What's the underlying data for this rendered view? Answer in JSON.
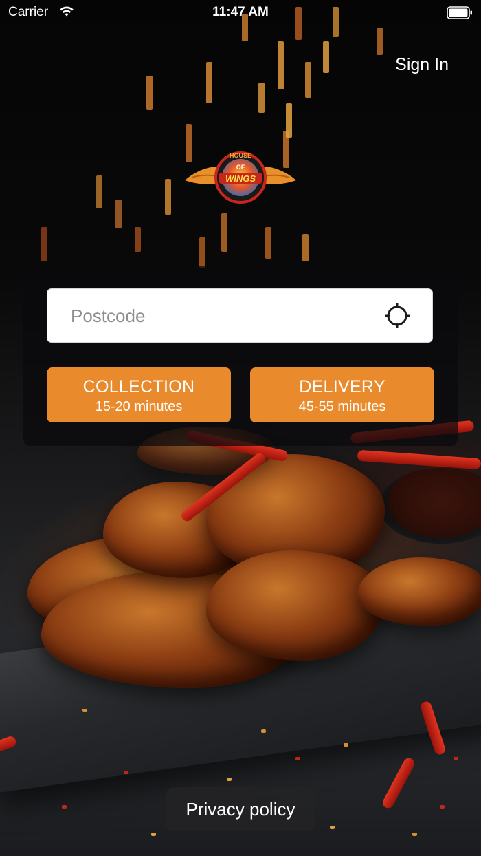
{
  "status_bar": {
    "carrier": "Carrier",
    "time": "11:47 AM",
    "wifi_icon": "wifi-icon",
    "battery_icon": "battery-icon"
  },
  "header": {
    "sign_in_label": "Sign In"
  },
  "logo": {
    "icon": "house-of-wings-logo",
    "line1": "HOUSE",
    "line2": "OF",
    "line3": "WINGS"
  },
  "search": {
    "placeholder": "Postcode",
    "value": "",
    "locate_icon": "crosshair-icon"
  },
  "options": [
    {
      "title": "COLLECTION",
      "subtitle": "15-20 minutes"
    },
    {
      "title": "DELIVERY",
      "subtitle": "45-55 minutes"
    }
  ],
  "footer": {
    "privacy_label": "Privacy policy"
  },
  "colors": {
    "accent": "#e98b2c",
    "background": "#0b0b0c",
    "panel": "#0a0a0c"
  }
}
